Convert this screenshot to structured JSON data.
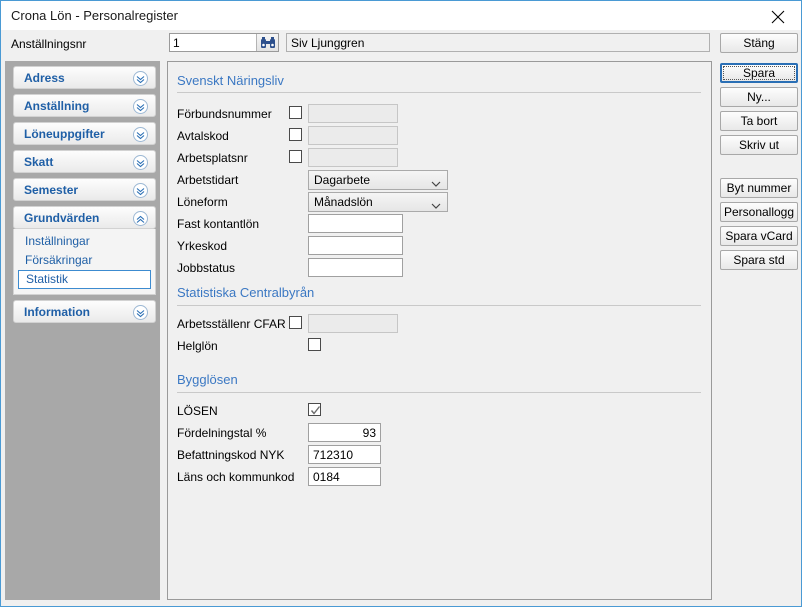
{
  "window": {
    "title": "Crona Lön - Personalregister",
    "close_icon": "close-icon"
  },
  "topbar": {
    "employee_nr_label": "Anställningsnr",
    "employee_nr_value": "1",
    "search_icon": "binoculars-icon",
    "employee_name": "Siv Ljunggren"
  },
  "buttons": {
    "stang": "Stäng",
    "spara": "Spara",
    "ny": "Ny...",
    "ta_bort": "Ta bort",
    "skriv_ut": "Skriv ut",
    "byt_nummer": "Byt nummer",
    "personallogg": "Personallogg",
    "spara_vcard": "Spara vCard",
    "spara_std": "Spara std"
  },
  "sidebar": {
    "groups": [
      {
        "label": "Adress",
        "expanded": false,
        "icon": "chevron-down-icon"
      },
      {
        "label": "Anställning",
        "expanded": false,
        "icon": "chevron-down-icon"
      },
      {
        "label": "Löneuppgifter",
        "expanded": false,
        "icon": "chevron-down-icon"
      },
      {
        "label": "Skatt",
        "expanded": false,
        "icon": "chevron-down-icon"
      },
      {
        "label": "Semester",
        "expanded": false,
        "icon": "chevron-down-icon"
      },
      {
        "label": "Grundvärden",
        "expanded": true,
        "icon": "chevron-up-icon"
      },
      {
        "label": "Information",
        "expanded": false,
        "icon": "chevron-down-icon"
      }
    ],
    "grundvarden_items": [
      {
        "label": "Inställningar",
        "selected": false
      },
      {
        "label": "Försäkringar",
        "selected": false
      },
      {
        "label": "Statistik",
        "selected": true
      }
    ]
  },
  "form": {
    "section1": {
      "title": "Svenskt Näringsliv",
      "forbundsnummer_label": "Förbundsnummer",
      "forbundsnummer_value": "",
      "forbundsnummer_checked": false,
      "avtalskod_label": "Avtalskod",
      "avtalskod_value": "",
      "avtalskod_checked": false,
      "arbetsplatsnr_label": "Arbetsplatsnr",
      "arbetsplatsnr_value": "",
      "arbetsplatsnr_checked": false,
      "arbetstidart_label": "Arbetstidart",
      "arbetstidart_value": "Dagarbete",
      "loneform_label": "Löneform",
      "loneform_value": "Månadslön",
      "fast_kontantlon_label": "Fast kontantlön",
      "fast_kontantlon_value": "",
      "yrkeskod_label": "Yrkeskod",
      "yrkeskod_value": "",
      "jobbstatus_label": "Jobbstatus",
      "jobbstatus_value": ""
    },
    "section2": {
      "title": "Statistiska Centralbyrån",
      "arbetsstallenr_label": "Arbetsställenr CFAR",
      "arbetsstallenr_value": "",
      "arbetsstallenr_checked": false,
      "helglon_label": "Helglön",
      "helglon_checked": false
    },
    "section3": {
      "title": "Bygglösen",
      "losen_label": "LÖSEN",
      "losen_checked": true,
      "fordelningstal_label": "Fördelningstal %",
      "fordelningstal_value": "93",
      "befattningskod_label": "Befattningskod NYK",
      "befattningskod_value": "712310",
      "lanskommunkod_label": "Läns och kommunkod",
      "lanskommunkod_value": "0184"
    }
  },
  "colors": {
    "accent_blue": "#3b78c3",
    "nav_blue": "#1f5fa6",
    "focus_blue": "#2a6fb5",
    "window_border": "#4a9ad4",
    "sidebar_bg": "#a8a8a8"
  }
}
